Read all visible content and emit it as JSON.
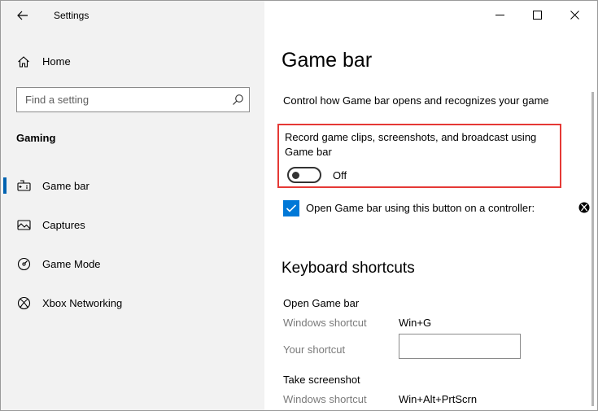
{
  "window": {
    "title": "Settings"
  },
  "sidebar": {
    "home_label": "Home",
    "search": {
      "placeholder": "Find a setting"
    },
    "section_title": "Gaming",
    "items": [
      {
        "label": "Game bar",
        "icon": "game-bar-icon",
        "active": true
      },
      {
        "label": "Captures",
        "icon": "captures-icon",
        "active": false
      },
      {
        "label": "Game Mode",
        "icon": "game-mode-icon",
        "active": false
      },
      {
        "label": "Xbox Networking",
        "icon": "xbox-icon",
        "active": false
      }
    ]
  },
  "main": {
    "title": "Game bar",
    "description": "Control how Game bar opens and recognizes your game",
    "record_setting": {
      "label": "Record game clips, screenshots, and broadcast using Game bar",
      "toggle_state": "Off"
    },
    "controller_checkbox": {
      "label": "Open Game bar using this button on a controller:",
      "checked": true
    },
    "shortcuts": {
      "heading": "Keyboard shortcuts",
      "groups": [
        {
          "title": "Open Game bar",
          "windows_shortcut_label": "Windows shortcut",
          "windows_shortcut_value": "Win+G",
          "your_shortcut_label": "Your shortcut",
          "your_shortcut_value": ""
        },
        {
          "title": "Take screenshot",
          "windows_shortcut_label": "Windows shortcut",
          "windows_shortcut_value": "Win+Alt+PrtScrn"
        }
      ]
    }
  },
  "colors": {
    "accent": "#0078d7",
    "highlight_border": "#e53935",
    "sidebar_bg": "#f2f2f2"
  }
}
